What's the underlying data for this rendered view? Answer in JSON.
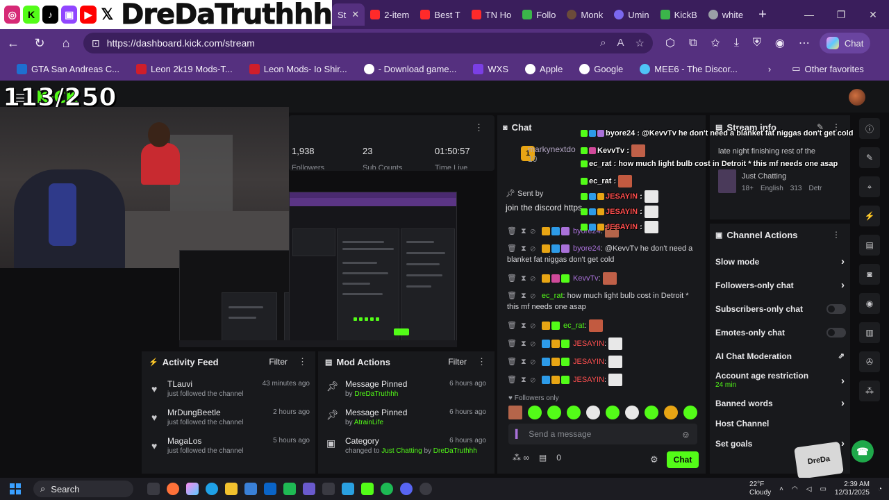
{
  "browser": {
    "tabs": [
      {
        "label": "St",
        "active": true,
        "color": "#ffffff"
      },
      {
        "label": "2-item",
        "color": "#ff2a2a"
      },
      {
        "label": "Best T",
        "color": "#ff2a2a"
      },
      {
        "label": "TN Ho",
        "color": "#ff2a2a"
      },
      {
        "label": "Follo",
        "color": "#3bb54a"
      },
      {
        "label": "Monk",
        "color": "#6b4b3a"
      },
      {
        "label": "Umin",
        "color": "#7b68ee"
      },
      {
        "label": "KickB",
        "color": "#3bb54a"
      },
      {
        "label": "white",
        "color": "#4285f4"
      }
    ],
    "url": "https://dashboard.kick.com/stream",
    "copilot_label": "Chat",
    "favorites": [
      {
        "label": "GTA San Andreas C...",
        "color": "#1e6fd0"
      },
      {
        "label": "Leon 2k19 Mods-T...",
        "color": "#d01e2a"
      },
      {
        "label": "Leon Mods- Io Shir...",
        "color": "#d01e2a"
      },
      {
        "label": "- Download game...",
        "color": "#ffffff"
      },
      {
        "label": "WXS",
        "color": "#7b3fe4"
      },
      {
        "label": "Apple",
        "color": "#ffffff"
      },
      {
        "label": "Google",
        "color": "#ffffff"
      },
      {
        "label": "MEE6 - The Discor...",
        "color": "#4fc3f7"
      }
    ],
    "other_favorites": "Other favorites"
  },
  "overlay": {
    "banner_name": "DreDaTruthhh",
    "sub_count": "113/250",
    "kick_logo": "KICK"
  },
  "stats": {
    "viewers": "1,938",
    "viewers_label": "Followers",
    "subs": "23",
    "subs_label": "Sub Counts",
    "time": "01:50:57",
    "time_label": "Time Live"
  },
  "activity_feed": {
    "title": "Activity Feed",
    "filter": "Filter",
    "items": [
      {
        "name": "TLauvi",
        "desc": "just followed the channel",
        "when": "43 minutes ago"
      },
      {
        "name": "MrDungBeetle",
        "desc": "just followed the channel",
        "when": "2 hours ago"
      },
      {
        "name": "MagaLos",
        "desc": "just followed the channel",
        "when": "5 hours ago"
      }
    ]
  },
  "mod_actions": {
    "title": "Mod Actions",
    "filter": "Filter",
    "items": [
      {
        "title": "Message Pinned",
        "by_prefix": "by",
        "by": "DreDaTruthhh",
        "when": "6 hours ago"
      },
      {
        "title": "Message Pinned",
        "by_prefix": "by",
        "by": "AtrainLife",
        "when": "6 hours ago"
      },
      {
        "title": "Category",
        "by_prefix": "changed to",
        "category": "Just Chatting",
        "by_mid": "by",
        "by": "DreDaTruthhh",
        "when": "6 hours ago"
      }
    ]
  },
  "chat": {
    "title": "Chat",
    "top_user": "markynextdo",
    "top_count": "10",
    "rank_badge": "1",
    "pinned_sent_by": "Sent by",
    "pinned_msg": "join the discord https",
    "messages": [
      {
        "user": "byore24",
        "user_class": "u-purple",
        "text": ""
      },
      {
        "user": "byore24",
        "user_class": "u-purple",
        "text": "@KevvTv he don't need a blanket fat niggas don't get cold"
      },
      {
        "user": "KevvTv",
        "user_class": "u-purple",
        "text": ""
      },
      {
        "user": "ec_rat",
        "user_class": "u-green",
        "text": "how much light bulb cost in Detroit * this mf needs one asap"
      },
      {
        "user": "ec_rat",
        "user_class": "u-green",
        "text": ""
      },
      {
        "user": "JESAYIN",
        "user_class": "u-red",
        "text": ""
      },
      {
        "user": "JESAYIN",
        "user_class": "u-red",
        "text": ""
      },
      {
        "user": "JESAYIN",
        "user_class": "u-red",
        "text": ""
      }
    ],
    "followers_only": "Followers only",
    "input_placeholder": "Send a message",
    "viewers_count": "0",
    "send_label": "Chat"
  },
  "overlay_chat": [
    {
      "user": "byore24",
      "text": "@KevvTv he don't need a blanket fat niggas don't get cold"
    },
    {
      "user": "KevvTv",
      "text": ""
    },
    {
      "user": "ec_rat",
      "text": "how much light bulb cost in Detroit * this mf needs one asap"
    },
    {
      "user": "ec_rat",
      "text": ""
    },
    {
      "user": "JESAYIN",
      "text": ""
    },
    {
      "user": "JESAYIN",
      "text": ""
    },
    {
      "user": "JESAYIN",
      "text": ""
    }
  ],
  "stream_info": {
    "title": "Stream info",
    "stream_title": "late night finishing rest of the",
    "category": "Just Chatting",
    "tags": [
      "18+",
      "English",
      "313",
      "Detr"
    ]
  },
  "channel_actions": {
    "title": "Channel Actions",
    "rows": [
      {
        "label": "Slow mode",
        "kind": "chevron"
      },
      {
        "label": "Followers-only chat",
        "kind": "chevron"
      },
      {
        "label": "Subscribers-only chat",
        "kind": "toggle"
      },
      {
        "label": "Emotes-only chat",
        "kind": "toggle"
      },
      {
        "label": "AI Chat Moderation",
        "kind": "external"
      },
      {
        "label": "Account age restriction",
        "kind": "chevron",
        "sub": "24 min"
      },
      {
        "label": "Banned words",
        "kind": "chevron"
      },
      {
        "label": "Host Channel",
        "kind": "none"
      },
      {
        "label": "Set goals",
        "kind": "chevron"
      }
    ]
  },
  "taskbar": {
    "search": "Search",
    "weather_temp": "22°F",
    "weather_desc": "Cloudy",
    "time": "2:39 AM",
    "date": "12/31/2025"
  }
}
